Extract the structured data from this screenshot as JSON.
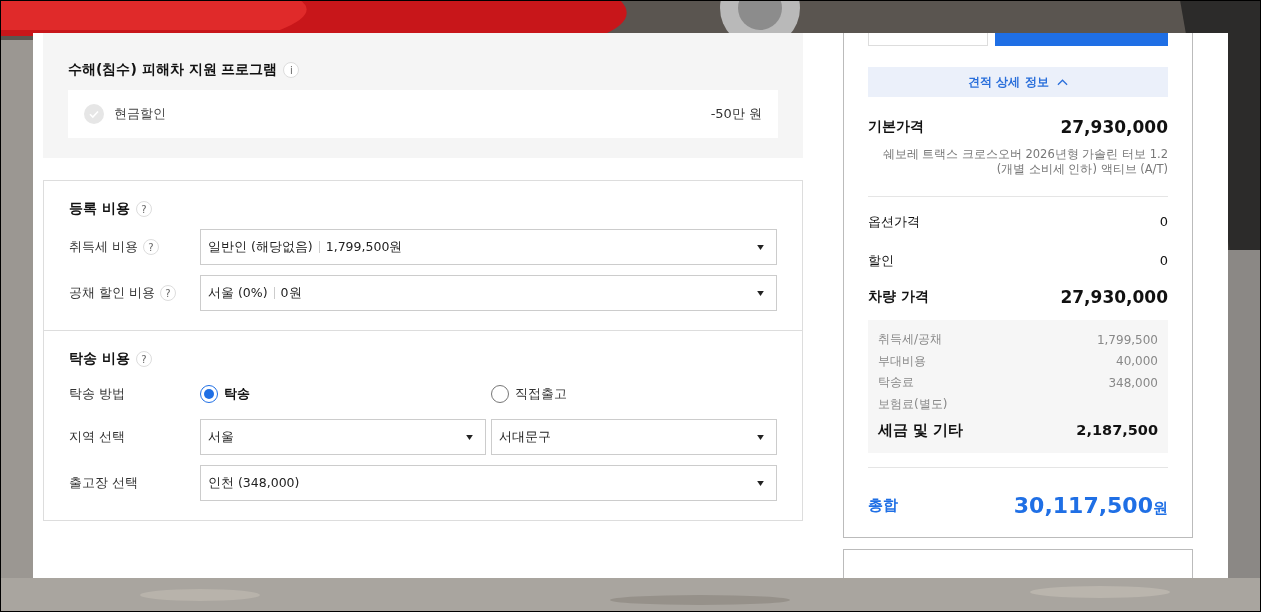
{
  "discount_program": {
    "title": "수해(침수) 피해차 지원 프로그램",
    "info": "i",
    "items": [
      {
        "label": "현금할인",
        "amount": "-50만 원",
        "checked": false
      }
    ]
  },
  "registration": {
    "title": "등록 비용",
    "help": "?",
    "rows": [
      {
        "label": "취득세 비용",
        "help": "?",
        "value": "일반인 (해당없음)",
        "amount": "1,799,500원"
      },
      {
        "label": "공채 할인 비용",
        "help": "?",
        "value": "서울 (0%)",
        "amount": "0원"
      }
    ]
  },
  "delivery": {
    "title": "탁송 비용",
    "help": "?",
    "method": {
      "label": "탁송 방법",
      "options": [
        {
          "label": "탁송",
          "selected": true
        },
        {
          "label": "직접출고",
          "selected": false
        }
      ]
    },
    "region": {
      "label": "지역 선택",
      "selects": [
        "서울",
        "서대문구"
      ]
    },
    "depot": {
      "label": "출고장 선택",
      "value": "인천 (348,000)"
    }
  },
  "summary": {
    "details_toggle": {
      "label": "견적 상세 정보",
      "expanded": true
    },
    "base": {
      "label": "기본가격",
      "value": "27,930,000",
      "description": "쉐보레 트랙스 크로스오버 2026년형 가솔린 터보 1.2 (개별 소비세 인하) 액티브 (A/T)"
    },
    "lines": [
      {
        "label": "옵션가격",
        "value": "0"
      },
      {
        "label": "할인",
        "value": "0"
      }
    ],
    "vehicle": {
      "label": "차량 가격",
      "value": "27,930,000"
    },
    "taxes": {
      "items": [
        {
          "label": "취득세/공채",
          "value": "1,799,500"
        },
        {
          "label": "부대비용",
          "value": "40,000"
        },
        {
          "label": "탁송료",
          "value": "348,000"
        },
        {
          "label": "보험료(별도)"
        }
      ],
      "total": {
        "label": "세금 및 기타",
        "value": "2,187,500"
      }
    },
    "total": {
      "label": "총합",
      "value": "30,117,500",
      "unit": "원"
    }
  }
}
